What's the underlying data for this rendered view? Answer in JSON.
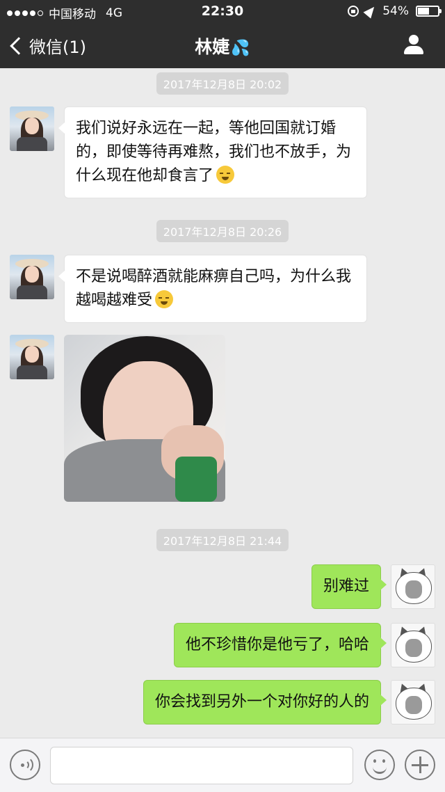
{
  "status_bar": {
    "carrier": "中国移动",
    "network": "4G",
    "time": "22:30",
    "battery": "54%",
    "battery_level": 0.54
  },
  "nav": {
    "back_label": "微信(1)",
    "title": "林婕",
    "title_emoji": "💦"
  },
  "messages": [
    {
      "type": "timestamp",
      "text": "2017年12月8日 20:02"
    },
    {
      "type": "text",
      "side": "in",
      "text": "我们说好永远在一起，等他回国就订婚的，即使等待再难熬，我们也不放手，为什么现在他却食言了",
      "emoji": "grinning-sweat-emoji"
    },
    {
      "type": "timestamp",
      "text": "2017年12月8日 20:26"
    },
    {
      "type": "text",
      "side": "in",
      "text": "不是说喝醉酒就能麻痹自己吗，为什么我越喝越难受",
      "emoji": "grinning-sweat-emoji"
    },
    {
      "type": "image",
      "side": "in",
      "description_icon": "crying-girl-photo"
    },
    {
      "type": "timestamp",
      "text": "2017年12月8日 21:44"
    },
    {
      "type": "text",
      "side": "out",
      "text": "别难过"
    },
    {
      "type": "text",
      "side": "out",
      "text": "他不珍惜你是他亏了，哈哈"
    },
    {
      "type": "text",
      "side": "out",
      "text": "你会找到另外一个对你好的人的"
    }
  ],
  "colors": {
    "header_bg": "#2e2e2e",
    "chat_bg": "#ebebeb",
    "out_bubble": "#9fe65a",
    "in_bubble": "#ffffff"
  },
  "input_bar": {
    "placeholder": ""
  }
}
